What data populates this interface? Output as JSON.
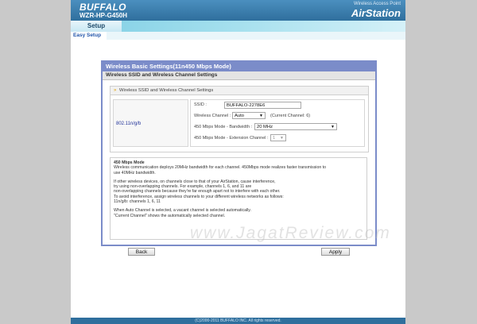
{
  "header": {
    "brand": "BUFFALO",
    "model": "WZR-HP-G450H",
    "tagline": "Wireless Access Point",
    "product": "AirStation"
  },
  "nav": {
    "tab_setup": "Setup",
    "sub_easy_setup": "Easy Setup"
  },
  "panel": {
    "title": "Wireless Basic Settings(11n450 Mbps Mode)",
    "subtitle": "Wireless SSID and Wireless Channel Settings",
    "section_title": "Wireless SSID and Wireless Channel Settings",
    "row_label": "802.11n/g/b",
    "ssid_label": "SSID :",
    "ssid_value": "BUFFALO-2278E6",
    "channel_label": "Wireless Channel :",
    "channel_value": "Auto",
    "current_channel": "(Current Channel: 6)",
    "bandwidth_label": "450 Mbps Mode - Bandwidth :",
    "bandwidth_value": "20 MHz",
    "extension_label": "450 Mbps Mode - Extension Channel :",
    "extension_value": "1"
  },
  "info": {
    "title": "450 Mbps Mode",
    "line1": "Wireless communication deploys 20MHz bandwidth for each channel. 450Mbps mode realizes faster transmission to",
    "line2": "use 40MHz bandwidth.",
    "line3": "If other wireless devices, on channels close to that of your AirStation, cause interference,",
    "line4": "try using non-overlapping channels. For example, channels 1, 6, and 11 are",
    "line5": "non-overlapping channels because they're far enough apart not to interfere with each other.",
    "line6": "To avoid interference, assign wireless channels to your different wireless networks as follows:",
    "line7": "11n/g/b: channels 1, 6, 11",
    "line8": "When Auto Channel is selected, a vacant channel is selected automatically.",
    "line9": "\"Current Channel\" shows the automatically selected channel."
  },
  "buttons": {
    "back": "Back",
    "apply": "Apply"
  },
  "watermark": "www.JagatReview.com",
  "footer": "(C)2000-2011 BUFFALO INC. All rights reserved.",
  "colors": {
    "header": "#2f6f9d",
    "panel_border": "#7b8cc9",
    "nav": "#a6e0ee"
  }
}
